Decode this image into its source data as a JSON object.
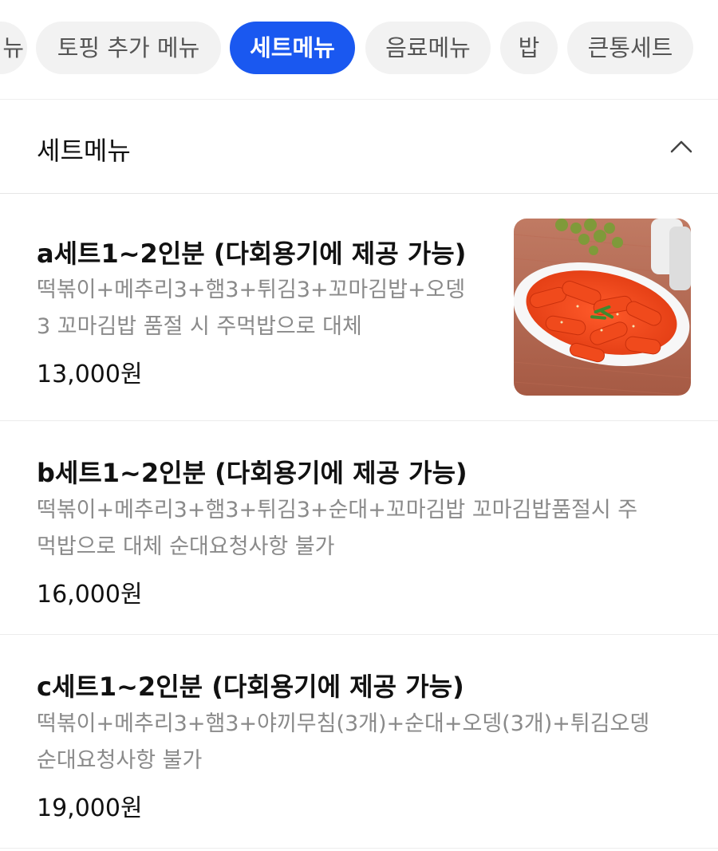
{
  "category_tabs": [
    {
      "label": "뉴"
    },
    {
      "label": "토핑 추가 메뉴"
    },
    {
      "label": "세트메뉴",
      "active": true
    },
    {
      "label": "음료메뉴"
    },
    {
      "label": "밥"
    },
    {
      "label": "큰통세트"
    }
  ],
  "section": {
    "title": "세트메뉴",
    "collapse_icon": "chevron-up-icon"
  },
  "items": [
    {
      "name": "a세트1~2인분 (다회용기에 제공 가능)",
      "desc_line1": "떡볶이+메추리3+햄3+튀김3+꼬마김밥+오뎅",
      "desc_line2": "3 꼬마김밥 품절 시 주먹밥으로 대체",
      "price": "13,000원",
      "has_image": true
    },
    {
      "name": "b세트1~2인분 (다회용기에 제공 가능)",
      "desc_line1": "떡볶이+메추리3+햄3+튀김3+순대+꼬마김밥 꼬마김밥품절시 주",
      "desc_line2": "먹밥으로 대체 순대요청사항 불가",
      "price": "16,000원"
    },
    {
      "name": "c세트1~2인분 (다회용기에 제공 가능)",
      "desc_line1": "떡볶이+메추리3+햄3+야끼무침(3개)+순대+오뎅(3개)+튀김오뎅",
      "desc_line2": "순대요청사항 불가",
      "price": "19,000원"
    }
  ],
  "colors": {
    "accent": "#1a58f0",
    "chip_bg": "#f2f2f2",
    "muted_text": "#8a8a8a"
  }
}
